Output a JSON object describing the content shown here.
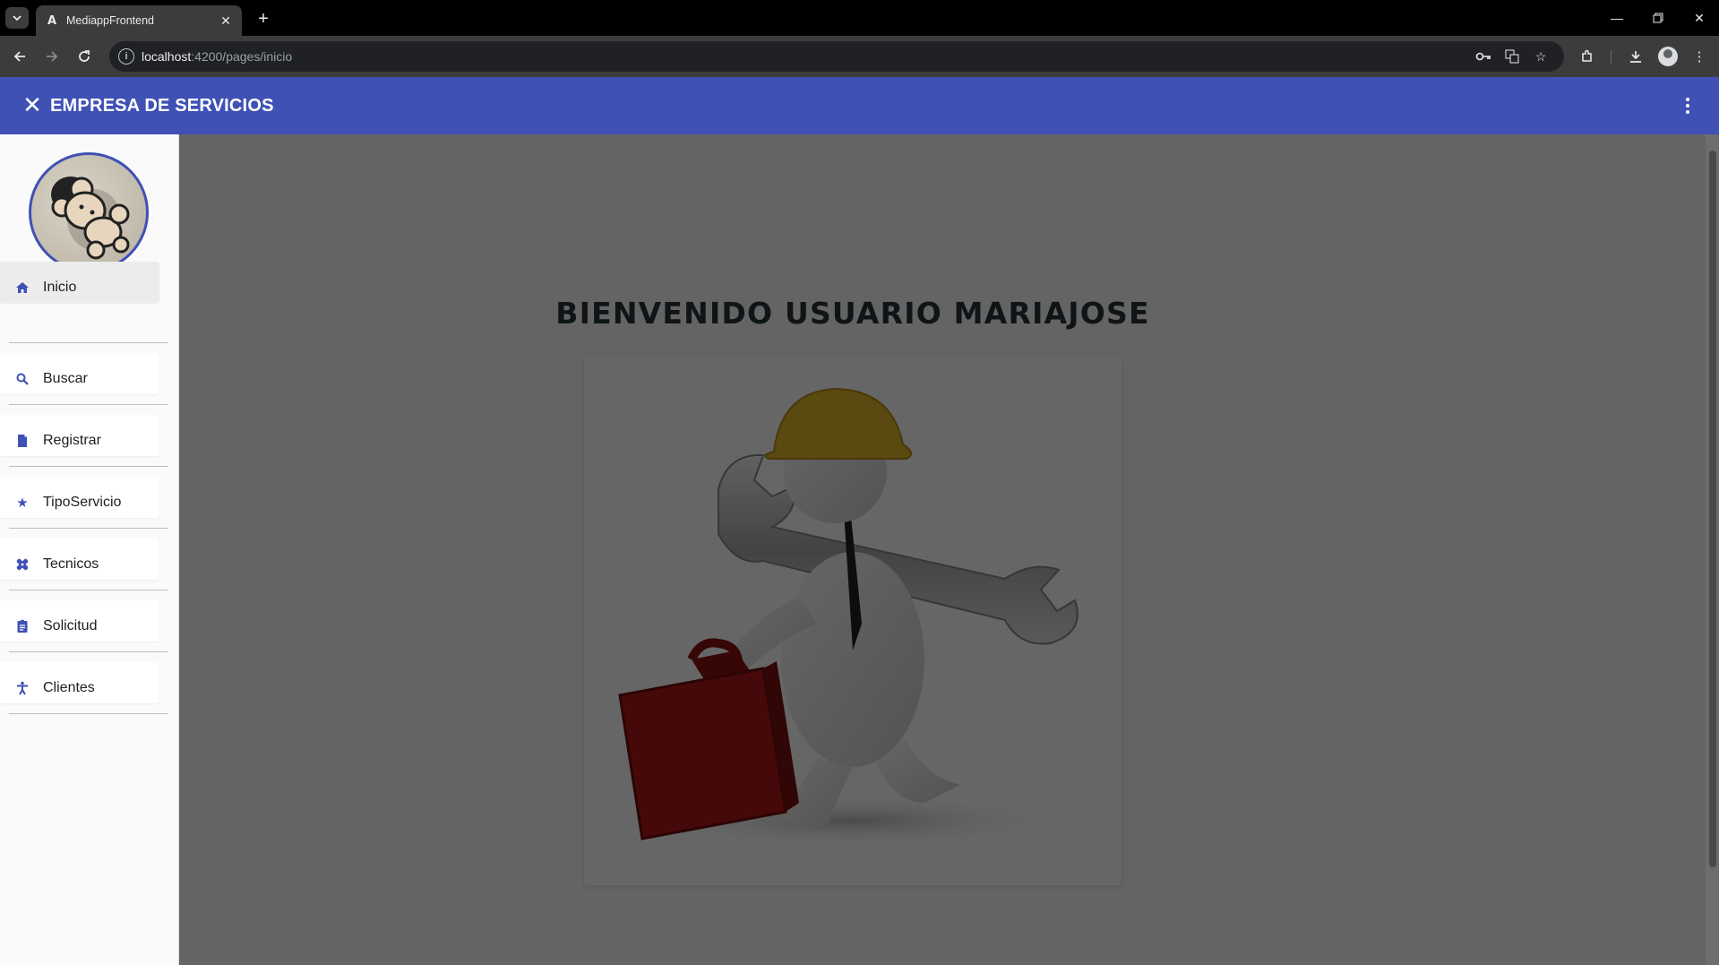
{
  "browser": {
    "tab_title": "MediappFrontend",
    "tab_favicon": "A",
    "url_host": "localhost",
    "url_path": ":4200/pages/inicio"
  },
  "app": {
    "title": "EMPRESA DE SERVICIOS",
    "welcome": "BIENVENIDO USUARIO MARIAJOSE",
    "accent_color": "#3f51b5",
    "nav": [
      {
        "label": "Inicio",
        "icon": "home-icon"
      },
      {
        "label": "Buscar",
        "icon": "search-icon"
      },
      {
        "label": "Registrar",
        "icon": "document-icon"
      },
      {
        "label": "TipoServicio",
        "icon": "star-icon"
      },
      {
        "label": "Tecnicos",
        "icon": "healing-icon"
      },
      {
        "label": "Solicitud",
        "icon": "assignment-icon"
      },
      {
        "label": "Clientes",
        "icon": "accessibility-icon"
      }
    ]
  }
}
